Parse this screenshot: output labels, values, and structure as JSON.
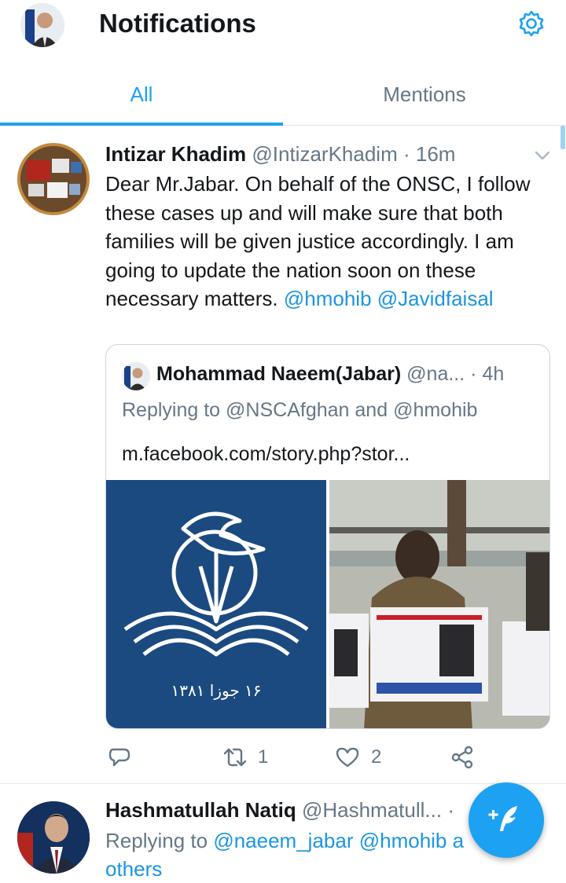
{
  "header": {
    "title": "Notifications",
    "avatar_icon": "user-avatar",
    "settings_icon": "gear-icon"
  },
  "tabs": [
    {
      "label": "All",
      "active": true
    },
    {
      "label": "Mentions",
      "active": false
    }
  ],
  "colors": {
    "accent": "#1da1f2",
    "link": "#1b95e0",
    "muted": "#657786",
    "text": "#14171a",
    "border": "#e1e8ed"
  },
  "notifications": [
    {
      "name": "Intizar Khadim",
      "handle": "@IntizarKhadim",
      "separator": "·",
      "time": "16m",
      "text": "Dear Mr.Jabar. On behalf of the ONSC, I follow these cases up and will make sure that both families will be given justice accordingly. I am going to update the nation soon on these necessary matters.",
      "mentions": [
        "@hmohib",
        "@Javidfaisal"
      ],
      "quoted": {
        "name": "Mohammad Naeem(Jabar)",
        "handle": "@na...",
        "separator": "·",
        "time": "4h",
        "reply_prefix": "Replying to",
        "reply_to_1": "@NSCAfghan",
        "reply_and": "and",
        "reply_to_2": "@hmohib",
        "link_text": "m.facebook.com/story.php?stor...",
        "media_left_text": "۱۶ جوزا ۱۳۸۱"
      },
      "actions": {
        "reply_count": "",
        "retweet_count": "1",
        "like_count": "2"
      }
    },
    {
      "name": "Hashmatullah Natiq",
      "handle": "@Hashmatull...",
      "separator": "·",
      "reply_prefix": "Replying to",
      "reply_to_1": "@naeem_jabar",
      "reply_to_2": "@hmohib",
      "reply_suffix_partial": "a",
      "reply_others": "others"
    }
  ],
  "fab": {
    "icon": "compose-tweet-icon"
  }
}
